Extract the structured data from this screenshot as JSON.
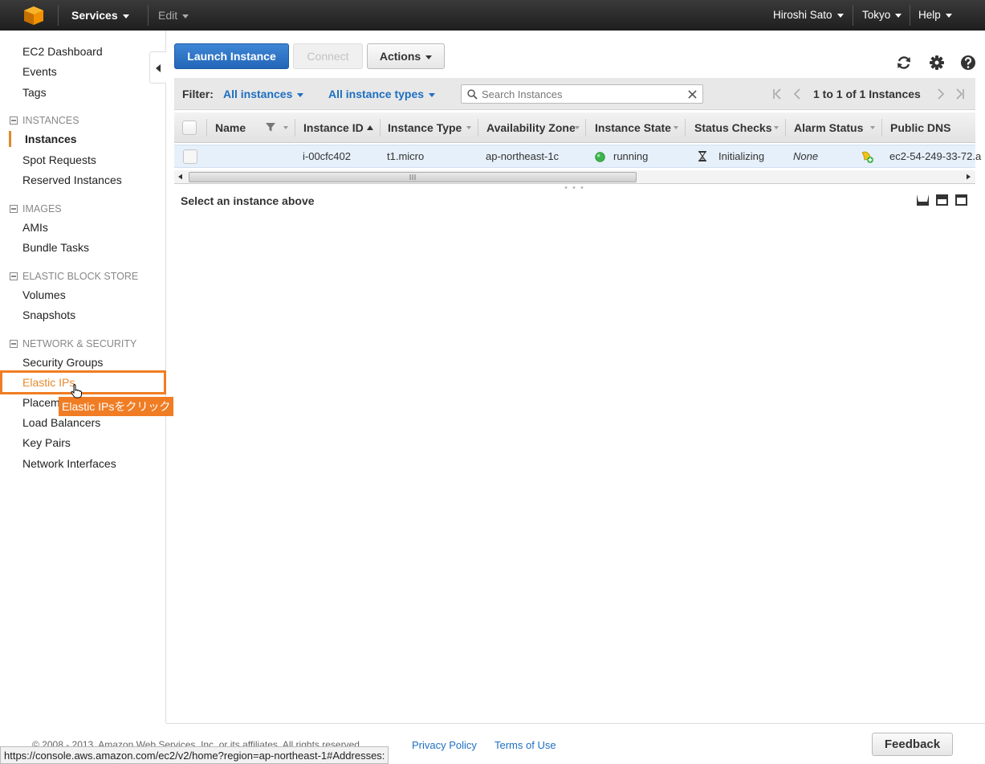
{
  "topnav": {
    "services": "Services",
    "edit": "Edit",
    "user": "Hiroshi Sato",
    "region": "Tokyo",
    "help": "Help"
  },
  "sidebar": {
    "top": [
      "EC2 Dashboard",
      "Events",
      "Tags"
    ],
    "instances_head": "INSTANCES",
    "instances": [
      "Instances",
      "Spot Requests",
      "Reserved Instances"
    ],
    "images_head": "IMAGES",
    "images": [
      "AMIs",
      "Bundle Tasks"
    ],
    "ebs_head": "ELASTIC BLOCK STORE",
    "ebs": [
      "Volumes",
      "Snapshots"
    ],
    "net_head": "NETWORK & SECURITY",
    "net": [
      "Security Groups",
      "Elastic IPs",
      "Placem",
      "Load Balancers",
      "Key Pairs",
      "Network Interfaces"
    ]
  },
  "toolbar": {
    "launch": "Launch Instance",
    "connect": "Connect",
    "actions": "Actions"
  },
  "filter": {
    "label": "Filter:",
    "instances": "All instances",
    "types": "All instance types",
    "search_placeholder": "Search Instances",
    "pager": "1 to 1 of 1 Instances"
  },
  "table": {
    "columns": [
      "Name",
      "Instance ID",
      "Instance Type",
      "Availability Zone",
      "Instance State",
      "Status Checks",
      "Alarm Status",
      "Public DNS"
    ],
    "row": {
      "instance_id": "i-00cfc402",
      "type": "t1.micro",
      "zone": "ap-northeast-1c",
      "state": "running",
      "checks": "Initializing",
      "alarm": "None",
      "dns": "ec2-54-249-33-72.a"
    }
  },
  "detail": {
    "title": "Select an instance above"
  },
  "footer": {
    "copyright": "© 2008 - 2013, Amazon Web Services, Inc. or its affiliates. All rights reserved.",
    "privacy": "Privacy Policy",
    "terms": "Terms of Use",
    "feedback": "Feedback"
  },
  "status_url": "https://console.aws.amazon.com/ec2/v2/home?region=ap-northeast-1#Addresses:",
  "annotation": {
    "tooltip": "Elastic IPsをクリック"
  },
  "colors": {
    "accent": "#1e6fc1",
    "launch_button": "#2a72c4",
    "highlight": "#f07d24",
    "running": "#3cb44b"
  }
}
